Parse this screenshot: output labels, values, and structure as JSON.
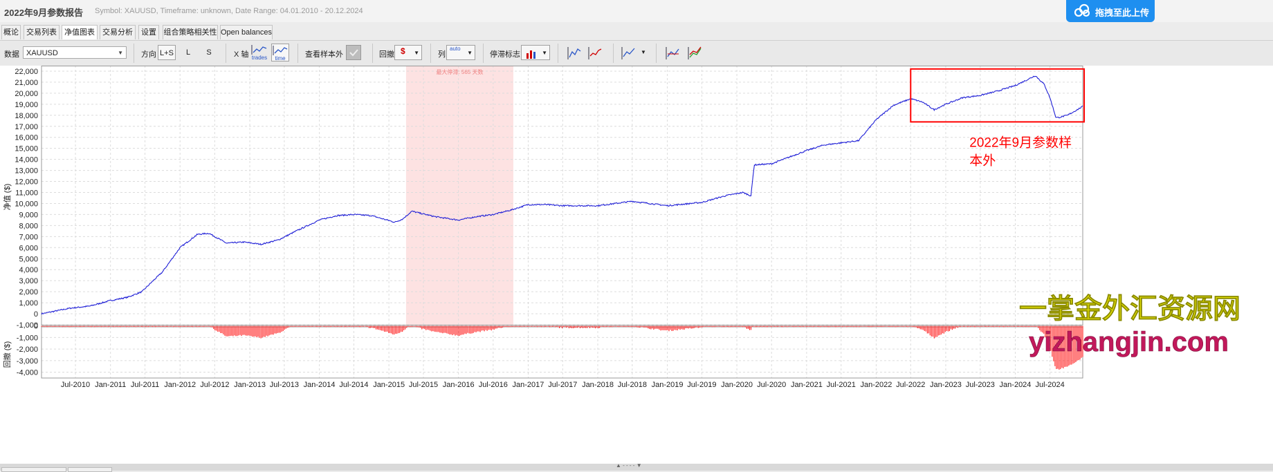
{
  "window": {
    "title": "2022年9月参数报告",
    "subtitle": "Symbol: XAUUSD, Timeframe: unknown, Date Range: 04.01.2010 - 20.12.2024",
    "upload_button": "拖拽至此上传"
  },
  "tabs": [
    "概论",
    "交易列表",
    "净值图表",
    "交易分析",
    "设置",
    "组合策略相关性",
    "Open balances"
  ],
  "active_tab": "净值图表",
  "toolbar": {
    "data_label": "数据",
    "data_value": "XAUUSD",
    "direction_label": "方向",
    "direction_options": [
      "L+S",
      "L",
      "S"
    ],
    "xaxis_label": "X 轴",
    "xaxis_trades": "trades",
    "xaxis_time": "time",
    "oos_label": "查看样本外",
    "drawdown_label": "回撤",
    "drawdown_icon": "$",
    "column_label": "列",
    "column_value": "auto",
    "stagnation_label": "停滞标志"
  },
  "chart_data": {
    "type": "line",
    "ylabel": "净值 ($)",
    "ylim": [
      -1000,
      22500
    ],
    "yticks": [
      -1000,
      0,
      1000,
      2000,
      3000,
      4000,
      5000,
      6000,
      7000,
      8000,
      9000,
      10000,
      11000,
      12000,
      13000,
      14000,
      15000,
      16000,
      17000,
      18000,
      19000,
      20000,
      21000,
      22000
    ],
    "ytick_labels": [
      "-1,000",
      "0",
      "1,000",
      "2,000",
      "3,000",
      "4,000",
      "5,000",
      "6,000",
      "7,000",
      "8,000",
      "9,000",
      "10,000",
      "11,000",
      "12,000",
      "13,000",
      "14,000",
      "15,000",
      "16,000",
      "17,000",
      "18,000",
      "19,000",
      "20,000",
      "21,000",
      "22,000"
    ],
    "xrange": [
      "2010-01-04",
      "2024-12-20"
    ],
    "xtick_labels": [
      "Jul-2010",
      "Jan-2011",
      "Jul-2011",
      "Jan-2012",
      "Jul-2012",
      "Jan-2013",
      "Jul-2013",
      "Jan-2014",
      "Jul-2014",
      "Jan-2015",
      "Jul-2015",
      "Jan-2016",
      "Jul-2016",
      "Jan-2017",
      "Jul-2017",
      "Jan-2018",
      "Jul-2018",
      "Jan-2019",
      "Jul-2019",
      "Jan-2020",
      "Jul-2020",
      "Jan-2021",
      "Jul-2021",
      "Jan-2022",
      "Jul-2022",
      "Jan-2023",
      "Jul-2023",
      "Jan-2024",
      "Jul-2024"
    ],
    "xtick_dates": [
      "2010-07-01",
      "2011-01-01",
      "2011-07-01",
      "2012-01-01",
      "2012-07-01",
      "2013-01-01",
      "2013-07-01",
      "2014-01-01",
      "2014-07-01",
      "2015-01-01",
      "2015-07-01",
      "2016-01-01",
      "2016-07-01",
      "2017-01-01",
      "2017-07-01",
      "2018-01-01",
      "2018-07-01",
      "2019-01-01",
      "2019-07-01",
      "2020-01-01",
      "2020-07-01",
      "2021-01-01",
      "2021-07-01",
      "2022-01-01",
      "2022-07-01",
      "2023-01-01",
      "2023-07-01",
      "2024-01-01",
      "2024-07-01"
    ],
    "grid": true,
    "series": [
      {
        "color": "#1f1fd6",
        "x": [
          "2010-01-04",
          "2010-06-01",
          "2010-09-15",
          "2011-01-01",
          "2011-04-01",
          "2011-06-15",
          "2011-08-01",
          "2011-10-01",
          "2012-01-01",
          "2012-04-01",
          "2012-06-01",
          "2012-09-01",
          "2012-12-01",
          "2013-03-01",
          "2013-06-01",
          "2013-09-01",
          "2014-01-01",
          "2014-04-01",
          "2014-07-01",
          "2014-10-01",
          "2015-02-01",
          "2015-03-15",
          "2015-05-01",
          "2015-09-01",
          "2016-01-01",
          "2016-04-01",
          "2016-07-01",
          "2016-10-01",
          "2017-01-01",
          "2017-04-01",
          "2017-07-01",
          "2018-01-01",
          "2018-07-01",
          "2019-01-01",
          "2019-07-01",
          "2019-11-01",
          "2020-02-01",
          "2020-03-15",
          "2020-04-01",
          "2020-07-01",
          "2020-10-01",
          "2021-01-01",
          "2021-04-01",
          "2021-07-01",
          "2021-10-01",
          "2022-01-01",
          "2022-04-01",
          "2022-07-01",
          "2022-09-01",
          "2022-11-01",
          "2023-01-01",
          "2023-04-01",
          "2023-07-01",
          "2023-10-01",
          "2024-01-01",
          "2024-03-01",
          "2024-04-15",
          "2024-06-01",
          "2024-07-01",
          "2024-08-01",
          "2024-08-15",
          "2024-10-01",
          "2024-12-20"
        ],
        "y": [
          0,
          500,
          700,
          1200,
          1500,
          2000,
          2800,
          3800,
          6000,
          7200,
          7300,
          6400,
          6500,
          6300,
          6700,
          7500,
          8500,
          8900,
          9000,
          8900,
          8300,
          8600,
          9300,
          8800,
          8500,
          8800,
          9000,
          9400,
          9900,
          9900,
          9800,
          9800,
          10200,
          9800,
          10100,
          10700,
          11000,
          10700,
          13500,
          13600,
          14200,
          14800,
          15300,
          15500,
          15700,
          17600,
          18900,
          19500,
          19200,
          18500,
          19000,
          19600,
          19800,
          20200,
          20700,
          21200,
          21600,
          20800,
          19600,
          17800,
          17800,
          18000,
          18800
        ]
      }
    ],
    "drawdown": {
      "ylabel": "回撤 ($)",
      "ylim": [
        -4500,
        100
      ],
      "yticks": [
        0,
        -1000,
        -2000,
        -3000,
        -4000
      ],
      "ytick_labels": [
        "0",
        "-1,000",
        "-2,000",
        "-3,000",
        "-4,000"
      ],
      "color": "#ff0000",
      "max_depth": -4300
    },
    "stagnation": {
      "start": "2015-04-01",
      "end": "2016-10-15",
      "label": "最大停滞: 565 天数",
      "color": "#fde2e2"
    },
    "annotation": {
      "text_line1": "2022年9月参数样",
      "text_line2": "本外",
      "box_start": "2022-07-01",
      "box_end": "2024-12-20",
      "y_top": 22200,
      "y_bottom": 17400,
      "color": "#ff0000"
    },
    "watermark": {
      "line1": "一掌金外汇资源网",
      "line2": "yizhangjin.com"
    }
  }
}
